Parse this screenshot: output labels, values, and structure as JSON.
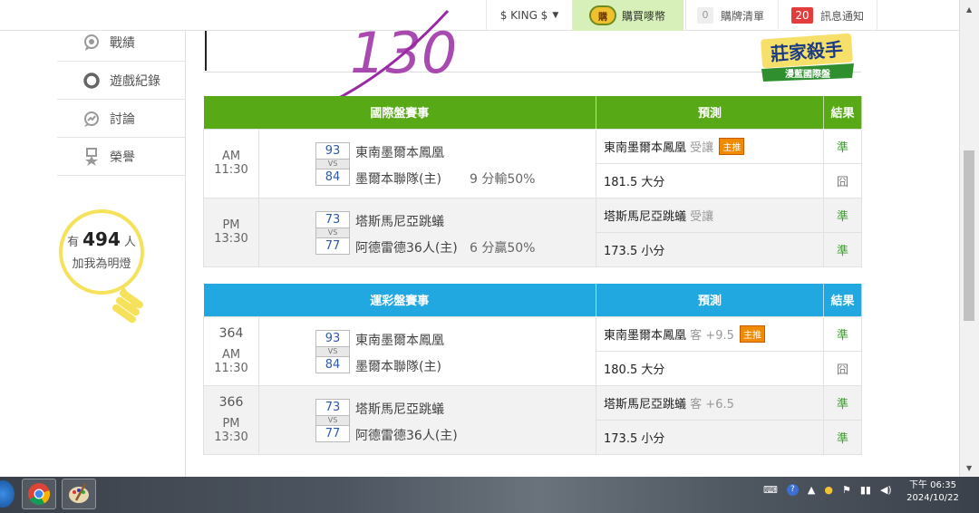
{
  "topbar": {
    "user": "$ KING $",
    "buy_badge": "購",
    "buy_label": "購買嘜幣",
    "cart_count": "0",
    "cart_label": "購牌清單",
    "msg_count": "20",
    "msg_label": "訊息通知"
  },
  "sidebar": {
    "items": [
      {
        "label": "戰績",
        "icon": "chat-icon"
      },
      {
        "label": "遊戲紀錄",
        "icon": "ring-icon"
      },
      {
        "label": "討論",
        "icon": "discussion-icon"
      },
      {
        "label": "榮譽",
        "icon": "medal-icon"
      }
    ],
    "bulb": {
      "prefix": "有",
      "count": "494",
      "suffix": "人",
      "line2": "加我為明燈"
    }
  },
  "handwriting": "130",
  "logo": {
    "line1": "莊家殺手",
    "line2": "漫藍國際盤"
  },
  "international": {
    "headers": {
      "match": "國際盤賽事",
      "pred": "預測",
      "result": "結果"
    },
    "games": [
      {
        "time": "AM 11:30",
        "team1": {
          "score": "93",
          "name": "東南墨爾本鳳凰"
        },
        "vs": "VS",
        "team2": {
          "score": "84",
          "name": "墨爾本聯隊(主)"
        },
        "note": "9 分輸50%",
        "pred1": {
          "team": "東南墨爾本鳳凰",
          "detail": "受讓",
          "tag": "主推",
          "result": "準"
        },
        "pred2": {
          "text": "181.5 大分",
          "result": "囧"
        }
      },
      {
        "time": "PM 13:30",
        "team1": {
          "score": "73",
          "name": "塔斯馬尼亞跳蟻"
        },
        "vs": "VS",
        "team2": {
          "score": "77",
          "name": "阿德雷德36人(主)"
        },
        "note": "6 分贏50%",
        "pred1": {
          "team": "塔斯馬尼亞跳蟻",
          "detail": "受讓",
          "tag": "",
          "result": "準"
        },
        "pred2": {
          "text": "173.5 小分",
          "result": "準"
        }
      }
    ]
  },
  "sports_lottery": {
    "headers": {
      "match": "運彩盤賽事",
      "pred": "預測",
      "result": "結果"
    },
    "games": [
      {
        "code": "364",
        "time": "AM 11:30",
        "team1": {
          "score": "93",
          "name": "東南墨爾本鳳凰"
        },
        "vs": "VS",
        "team2": {
          "score": "84",
          "name": "墨爾本聯隊(主)"
        },
        "pred1": {
          "team": "東南墨爾本鳳凰",
          "detail": "客 +9.5",
          "tag": "主推",
          "result": "準"
        },
        "pred2": {
          "text": "180.5 大分",
          "result": "囧"
        }
      },
      {
        "code": "366",
        "time": "PM 13:30",
        "team1": {
          "score": "73",
          "name": "塔斯馬尼亞跳蟻"
        },
        "vs": "VS",
        "team2": {
          "score": "77",
          "name": "阿德雷德36人(主)"
        },
        "pred1": {
          "team": "塔斯馬尼亞跳蟻",
          "detail": "客 +6.5",
          "tag": "",
          "result": "準"
        },
        "pred2": {
          "text": "173.5 小分",
          "result": "準"
        }
      }
    ]
  },
  "taskbar": {
    "time": "下午 06:35",
    "date": "2024/10/22"
  },
  "colors": {
    "green_header": "#57a916",
    "blue_header": "#21a8e0",
    "result_ok": "#3aa02a",
    "bulb_yellow": "#f5e25a",
    "tag_orange": "#f08a00"
  }
}
